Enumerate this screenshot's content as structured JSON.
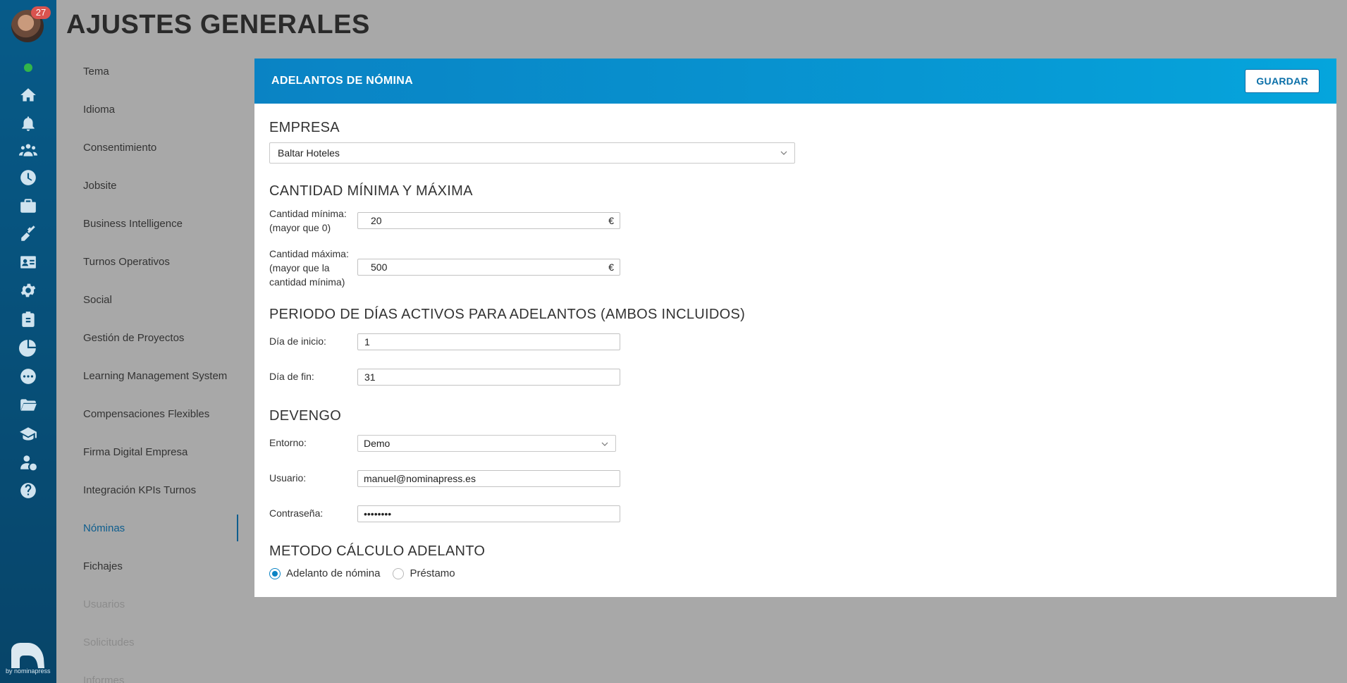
{
  "user": {
    "notification_count": "27"
  },
  "page": {
    "title": "AJUSTES GENERALES"
  },
  "rail": {
    "icons": [
      "home-icon",
      "bell-icon",
      "users-icon",
      "clock-icon",
      "briefcase-icon",
      "tools-icon",
      "id-card-icon",
      "gear-icon",
      "clipboard-icon",
      "pie-chart-icon",
      "chat-icon",
      "folder-icon",
      "graduation-cap-icon",
      "user-money-icon",
      "help-icon"
    ],
    "logo_text": "by nominapress"
  },
  "menu": {
    "items": [
      {
        "label": "Tema",
        "state": "normal"
      },
      {
        "label": "Idioma",
        "state": "normal"
      },
      {
        "label": "Consentimiento",
        "state": "normal"
      },
      {
        "label": "Jobsite",
        "state": "normal"
      },
      {
        "label": "Business Intelligence",
        "state": "normal"
      },
      {
        "label": "Turnos Operativos",
        "state": "normal"
      },
      {
        "label": "Social",
        "state": "normal"
      },
      {
        "label": "Gestión de Proyectos",
        "state": "normal"
      },
      {
        "label": "Learning Management System",
        "state": "normal"
      },
      {
        "label": "Compensaciones Flexibles",
        "state": "normal"
      },
      {
        "label": "Firma Digital Empresa",
        "state": "normal"
      },
      {
        "label": "Integración KPIs Turnos",
        "state": "normal"
      },
      {
        "label": "Nóminas",
        "state": "active"
      },
      {
        "label": "Fichajes",
        "state": "normal"
      },
      {
        "label": "Usuarios",
        "state": "disabled"
      },
      {
        "label": "Solicitudes",
        "state": "disabled"
      },
      {
        "label": "Informes",
        "state": "disabled"
      }
    ]
  },
  "card": {
    "title": "ADELANTOS DE NÓMINA",
    "save_label": "GUARDAR",
    "empresa": {
      "title": "EMPRESA",
      "selected": "Baltar Hoteles"
    },
    "cantidad": {
      "title": "CANTIDAD MÍNIMA Y MÁXIMA",
      "min_label_1": "Cantidad mínima:",
      "min_label_2": "(mayor que 0)",
      "min_value": "20",
      "max_label_1": "Cantidad máxima:",
      "max_label_2": "(mayor que la",
      "max_label_3": "cantidad mínima)",
      "max_value": "500",
      "currency": "€"
    },
    "periodo": {
      "title": "PERIODO DE DÍAS ACTIVOS PARA ADELANTOS (AMBOS INCLUIDOS)",
      "start_label": "Día de inicio:",
      "start_value": "1",
      "end_label": "Día de fin:",
      "end_value": "31"
    },
    "devengo": {
      "title": "DEVENGO",
      "entorno_label": "Entorno:",
      "entorno_value": "Demo",
      "usuario_label": "Usuario:",
      "usuario_value": "manuel@nominapress.es",
      "password_label": "Contraseña:",
      "password_value": "••••••••"
    },
    "metodo": {
      "title": "METODO CÁLCULO ADELANTO",
      "options": [
        {
          "label": "Adelanto de nómina",
          "checked": true
        },
        {
          "label": "Préstamo",
          "checked": false
        }
      ]
    }
  }
}
